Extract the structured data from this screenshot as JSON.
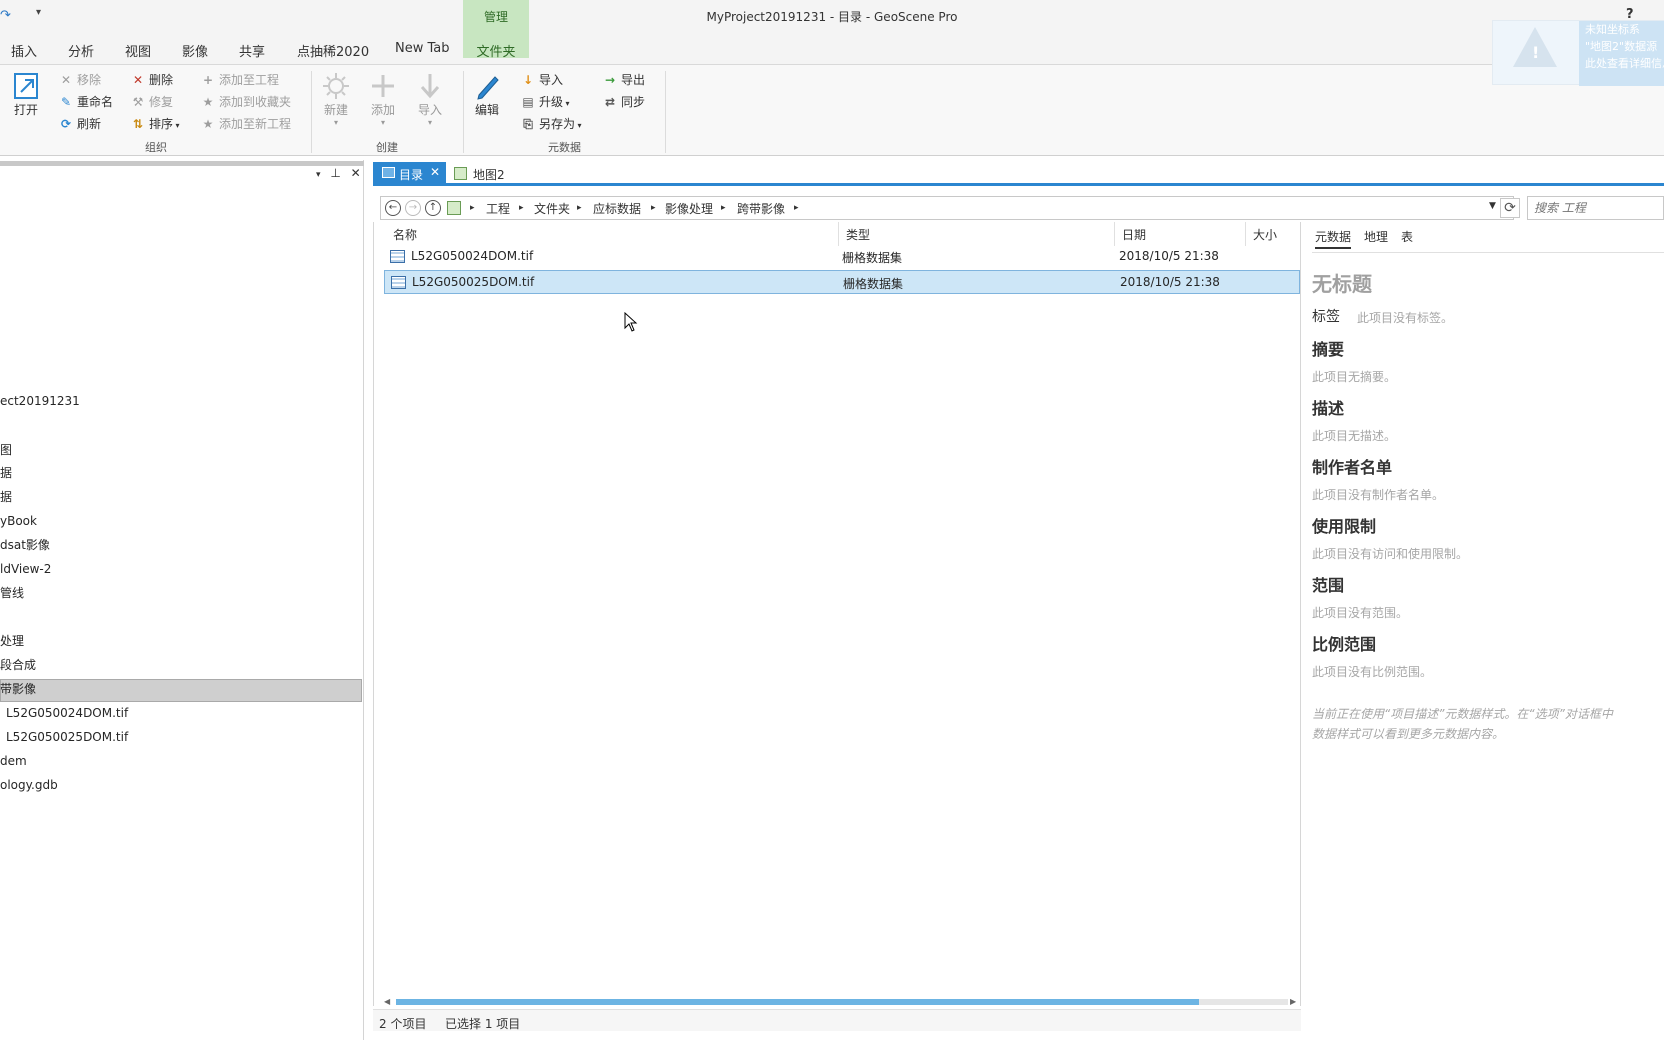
{
  "window": {
    "title": "MyProject20191231 - 目录 - GeoScene Pro",
    "help": "?",
    "context_tab_header": "管理"
  },
  "ribbon_tabs": [
    "插入",
    "分析",
    "视图",
    "影像",
    "共享",
    "点抽稀2020",
    "New Tab",
    "文件夹"
  ],
  "ribbon": {
    "open": "打开",
    "organize": {
      "label": "组织",
      "remove": "移除",
      "rename": "重命名",
      "refresh": "刷新",
      "delete": "删除",
      "repair": "修复",
      "sort": "排序",
      "add_to_project": "添加至工程",
      "add_to_favorites": "添加到收藏夹",
      "add_to_new_project": "添加至新工程"
    },
    "create": {
      "label": "创建",
      "new": "新建",
      "add": "添加",
      "import": "导入"
    },
    "metadata": {
      "label": "元数据",
      "edit": "编辑",
      "import": "导入",
      "upgrade": "升级",
      "save_as": "另存为",
      "export": "导出",
      "sync": "同步"
    }
  },
  "warning_popup": {
    "line1": "未知坐标系",
    "line2": "\"地图2\"数据源",
    "line3": "此处查看详细信息"
  },
  "left_pane": {
    "items": [
      "ect20191231",
      "图",
      "据",
      "据",
      "yBook",
      "dsat影像",
      "ldView-2",
      "管线",
      "处理",
      "段合成",
      "带影像",
      "L52G050024DOM.tif",
      "L52G050025DOM.tif",
      "dem",
      "ology.gdb"
    ],
    "selected_index": 10
  },
  "doc_tabs": {
    "catalog": "目录",
    "map": "地图2"
  },
  "breadcrumb": [
    "工程",
    "文件夹",
    "应标数据",
    "影像处理",
    "跨带影像"
  ],
  "search": {
    "placeholder": "搜索 工程"
  },
  "table": {
    "columns": [
      "名称",
      "类型",
      "日期",
      "大小"
    ],
    "rows": [
      {
        "name": "L52G050024DOM.tif",
        "type": "栅格数据集",
        "date": "2018/10/5 21:38",
        "selected": false
      },
      {
        "name": "L52G050025DOM.tif",
        "type": "栅格数据集",
        "date": "2018/10/5 21:38",
        "selected": true
      }
    ]
  },
  "status": {
    "count": "2 个项目",
    "selected": "已选择 1 项目"
  },
  "metadata_panel": {
    "tabs": [
      "元数据",
      "地理",
      "表"
    ],
    "untitled": "无标题",
    "tags_label": "标签",
    "tags_text": "此项目没有标签。",
    "summary_h": "摘要",
    "summary_t": "此项目无摘要。",
    "description_h": "描述",
    "description_t": "此项目无描述。",
    "credits_h": "制作者名单",
    "credits_t": "此项目没有制作者名单。",
    "use_h": "使用限制",
    "use_t": "此项目没有访问和使用限制。",
    "extent_h": "范围",
    "extent_t": "此项目没有范围。",
    "scale_h": "比例范围",
    "scale_t": "此项目没有比例范围。",
    "note_line1": "当前正在使用“项目描述”元数据样式。在“选项”对话框中",
    "note_line2": "数据样式可以看到更多元数据内容。"
  },
  "hscroll": {
    "thumb_fraction": 0.9
  },
  "colors": {
    "accent": "#2b86d0",
    "context_tab": "#c8e6c1",
    "selection": "#cde6f7"
  }
}
